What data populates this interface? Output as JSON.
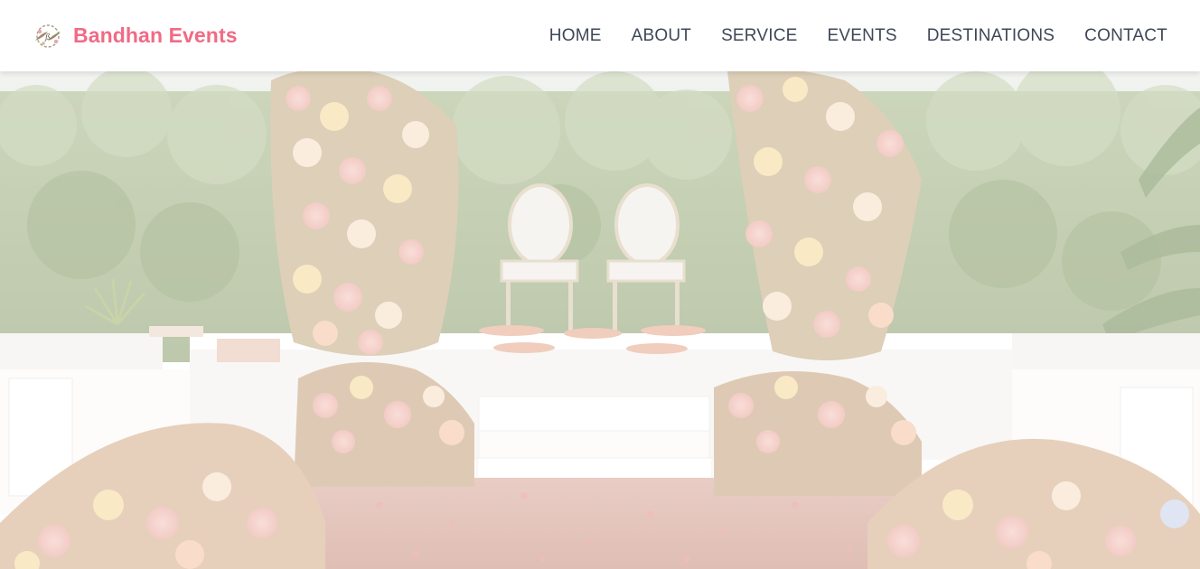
{
  "brand": {
    "name": "Bandhan Events",
    "logo_icon": "wreath-logo-icon",
    "color": "#f06b85"
  },
  "nav": {
    "items": [
      {
        "label": "HOME"
      },
      {
        "label": "ABOUT"
      },
      {
        "label": "SERVICE"
      },
      {
        "label": "EVENTS"
      },
      {
        "label": "DESTINATIONS"
      },
      {
        "label": "CONTACT"
      }
    ],
    "text_color": "#3f4757"
  },
  "hero": {
    "image": "wedding-mandap-floral-stage-image"
  }
}
